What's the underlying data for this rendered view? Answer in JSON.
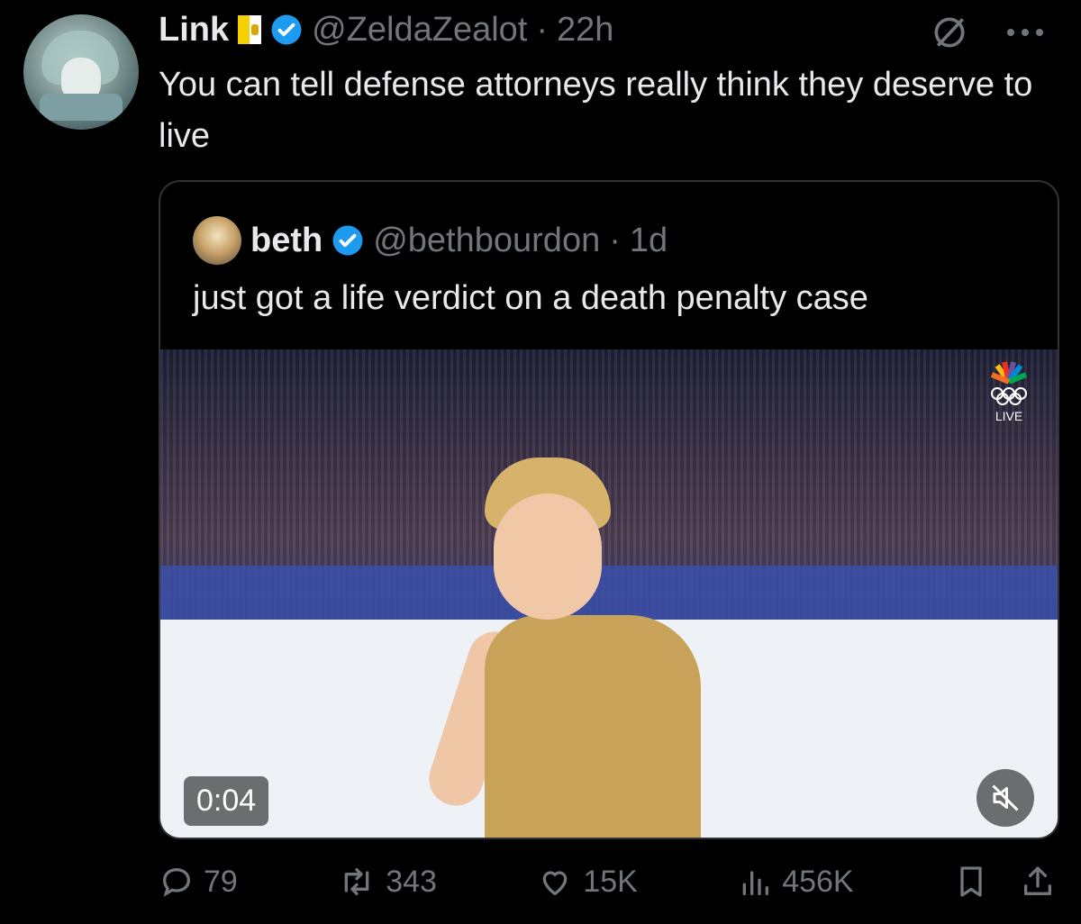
{
  "post": {
    "author_name": "Link",
    "handle": "@ZeldaZealot",
    "time_sep": "·",
    "time": "22h",
    "text": "You can tell defense attorneys really think they deserve to live",
    "top_icons": [
      "grok-icon",
      "more-icon"
    ]
  },
  "quoted": {
    "author_name": "beth",
    "handle": "@bethbourdon",
    "time_sep": "·",
    "time": "1d",
    "text": "just got a life verdict on a death penalty case",
    "media": {
      "live_label": "LIVE",
      "duration": "0:04"
    }
  },
  "actions": {
    "reply_count": "79",
    "retweet_count": "343",
    "like_count": "15K",
    "view_count": "456K"
  },
  "colors": {
    "background": "#000000",
    "text_primary": "#e7e9ea",
    "text_secondary": "#71767b",
    "verified": "#1d9bf0",
    "border": "#2f3336"
  }
}
